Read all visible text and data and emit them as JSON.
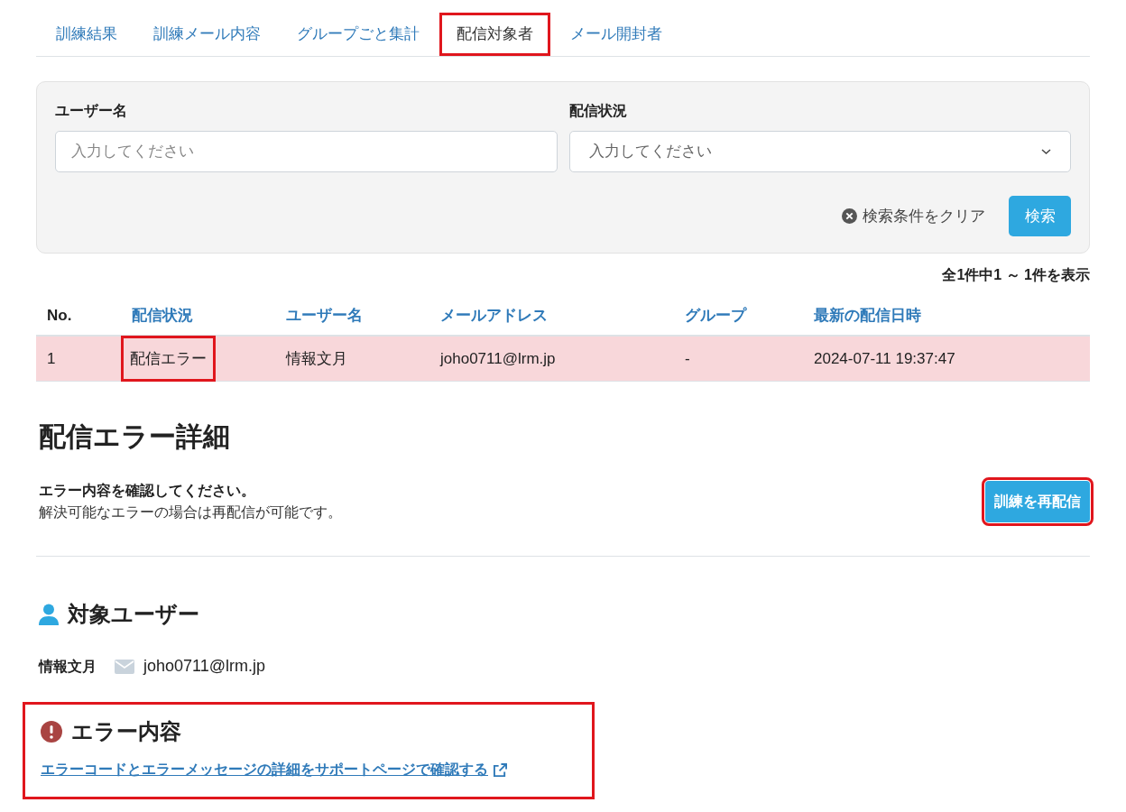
{
  "tabs": [
    {
      "label": "訓練結果",
      "selected": false,
      "highlighted": false
    },
    {
      "label": "訓練メール内容",
      "selected": false,
      "highlighted": false
    },
    {
      "label": "グループごと集計",
      "selected": false,
      "highlighted": false
    },
    {
      "label": "配信対象者",
      "selected": true,
      "highlighted": true
    },
    {
      "label": "メール開封者",
      "selected": false,
      "highlighted": false
    }
  ],
  "filters": [
    {
      "kind": "text",
      "label": "ユーザー名",
      "placeholder": "入力してください"
    },
    {
      "kind": "select",
      "label": "配信状況",
      "placeholder": "入力してください"
    }
  ],
  "clear_label": "検索条件をクリア",
  "search_button": "検索",
  "count": "全1件中1 ～ 1件を表示",
  "table": {
    "columns": [
      {
        "label": "No.",
        "sortable": false
      },
      {
        "label": "配信状況",
        "sortable": true
      },
      {
        "label": "ユーザー名",
        "sortable": true
      },
      {
        "label": "メールアドレス",
        "sortable": true
      },
      {
        "label": "グループ",
        "sortable": true
      },
      {
        "label": "最新の配信日時",
        "sortable": true
      }
    ],
    "rows": [
      {
        "error": true,
        "cells": [
          {
            "text": "1",
            "highlighted": false
          },
          {
            "text": "配信エラー",
            "highlighted": true
          },
          {
            "text": "情報文月",
            "highlighted": false
          },
          {
            "text": "joho0711@lrm.jp",
            "highlighted": false
          },
          {
            "text": "-",
            "highlighted": false
          },
          {
            "text": "2024-07-11 19:37:47",
            "highlighted": false
          }
        ]
      }
    ]
  },
  "detail": {
    "title": "配信エラー詳細",
    "lead": "エラー内容を確認してください。",
    "note": "解決可能なエラーの場合は再配信が可能です。",
    "resend_button": "訓練を再配信",
    "resend_highlighted": true
  },
  "target_user": {
    "title": "対象ユーザー",
    "name": "情報文月",
    "email": "joho0711@lrm.jp"
  },
  "error_section": {
    "title": "エラー内容",
    "link": "エラーコードとエラーメッセージの詳細をサポートページで確認する",
    "highlighted": true
  }
}
